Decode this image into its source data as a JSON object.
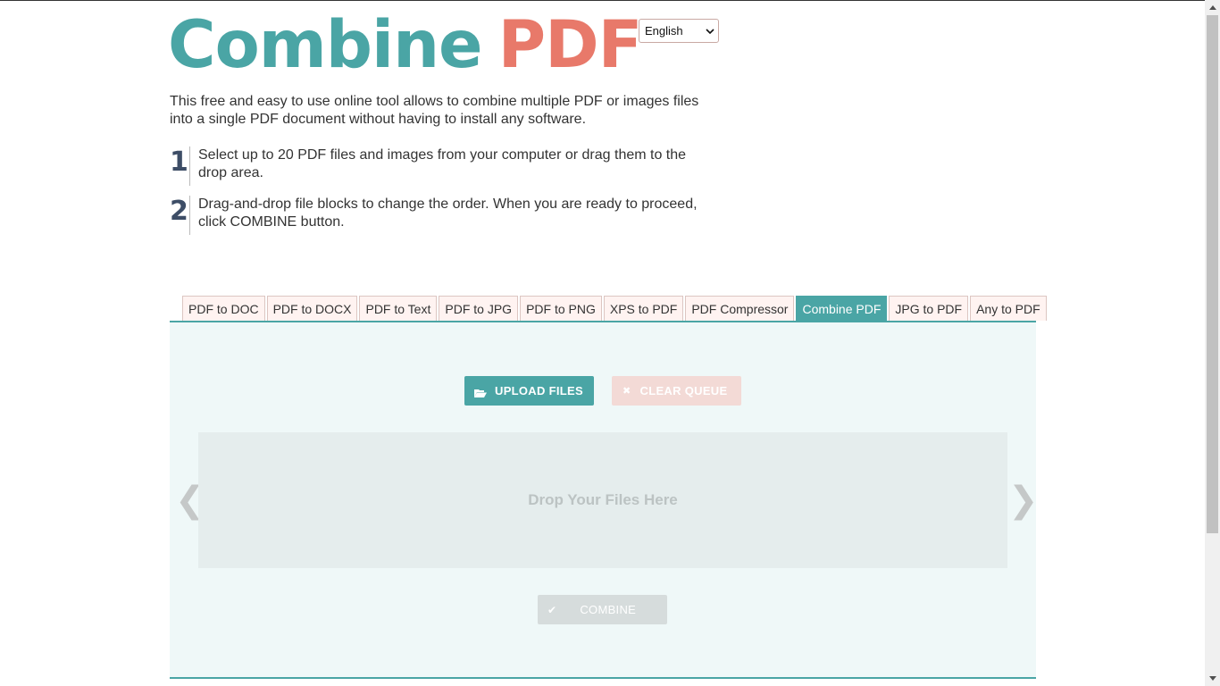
{
  "logo": {
    "word1": "Combine",
    "word2": "PDF"
  },
  "language": {
    "selected": "English"
  },
  "intro": "This free and easy to use online tool allows to combine multiple PDF or images files into a single PDF document without having to install any software.",
  "steps": [
    {
      "number": "1",
      "text": "Select up to 20 PDF files and images from your computer or drag them to the drop area."
    },
    {
      "number": "2",
      "text": "Drag-and-drop file blocks to change the order. When you are ready to proceed, click COMBINE button."
    }
  ],
  "tabs": [
    {
      "label": "PDF to DOC"
    },
    {
      "label": "PDF to DOCX"
    },
    {
      "label": "PDF to Text"
    },
    {
      "label": "PDF to JPG"
    },
    {
      "label": "PDF to PNG"
    },
    {
      "label": "XPS to PDF"
    },
    {
      "label": "PDF Compressor"
    },
    {
      "label": "Combine PDF",
      "active": true
    },
    {
      "label": "JPG to PDF"
    },
    {
      "label": "Any to PDF"
    }
  ],
  "buttons": {
    "upload": "UPLOAD FILES",
    "clear": "CLEAR QUEUE",
    "combine": "COMBINE"
  },
  "dropzone": {
    "label": "Drop Your Files Here"
  },
  "arrows": {
    "left": "❮",
    "right": "❯"
  },
  "icons": {
    "upload": "folder-open-icon",
    "clear": "close-icon",
    "combine": "checkmark-icon"
  },
  "colors": {
    "teal": "#4aa5a5",
    "salmon": "#e8796a",
    "panel": "#eff8f8"
  }
}
